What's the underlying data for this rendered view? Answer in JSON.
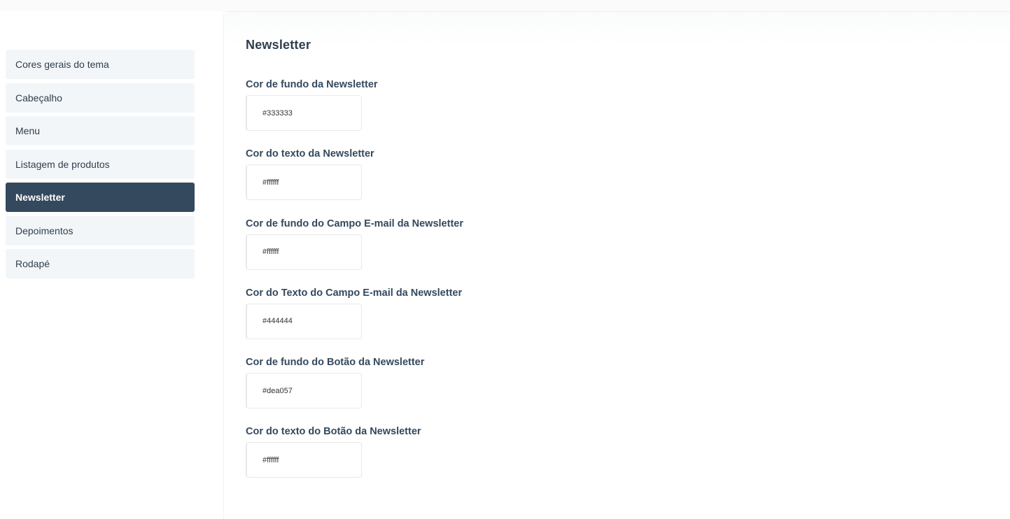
{
  "sidebar": {
    "items": [
      {
        "label": "Cores gerais do tema",
        "active": false
      },
      {
        "label": "Cabeçalho",
        "active": false
      },
      {
        "label": "Menu",
        "active": false
      },
      {
        "label": "Listagem de produtos",
        "active": false
      },
      {
        "label": "Newsletter",
        "active": true
      },
      {
        "label": "Depoimentos",
        "active": false
      },
      {
        "label": "Rodapé",
        "active": false
      }
    ]
  },
  "main": {
    "title": "Newsletter",
    "fields": [
      {
        "label": "Cor de fundo da Newsletter",
        "value": "#333333",
        "color": "#333333"
      },
      {
        "label": "Cor do texto da Newsletter",
        "value": "#ffffff",
        "color": "#ffffff"
      },
      {
        "label": "Cor de fundo do Campo E-mail da Newsletter",
        "value": "#ffffff",
        "color": "#ffffff"
      },
      {
        "label": "Cor do Texto do Campo E-mail da Newsletter",
        "value": "#444444",
        "color": "#444444"
      },
      {
        "label": "Cor de fundo do Botão da Newsletter",
        "value": "#dea057",
        "color": "#dea057"
      },
      {
        "label": "Cor do texto do Botão da Newsletter",
        "value": "#ffffff",
        "color": "#ffffff"
      }
    ]
  }
}
